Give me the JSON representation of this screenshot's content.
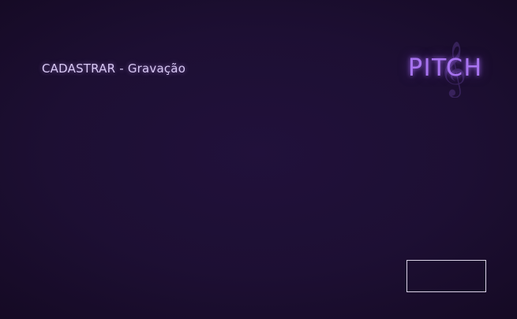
{
  "header": {
    "title": "CADASTRAR - Gravação"
  },
  "brand": {
    "name": "PITCH",
    "icon": "treble-clef-icon",
    "color": "#a874f0"
  },
  "footer": {
    "button_label": ""
  },
  "colors": {
    "background": "#1d0f33",
    "title_text": "#d8c8f4",
    "button_border": "#d9d2e6"
  }
}
